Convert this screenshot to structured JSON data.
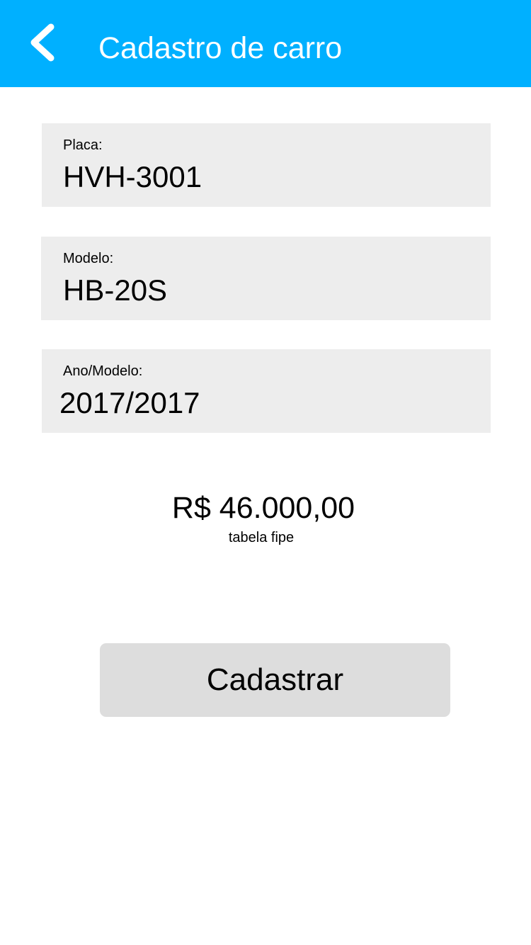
{
  "header": {
    "title": "Cadastro de carro",
    "back_icon": "chevron-left-icon",
    "color": "#00B0FF"
  },
  "form": {
    "placa": {
      "label": "Placa:",
      "value": "HVH-3001"
    },
    "modelo": {
      "label": "Modelo:",
      "value": "HB-20S"
    },
    "ano": {
      "label": "Ano/Modelo:",
      "value": "2017/2017"
    }
  },
  "price": {
    "value": "R$ 46.000,00",
    "caption": "tabela fipe"
  },
  "actions": {
    "submit_label": "Cadastrar"
  }
}
